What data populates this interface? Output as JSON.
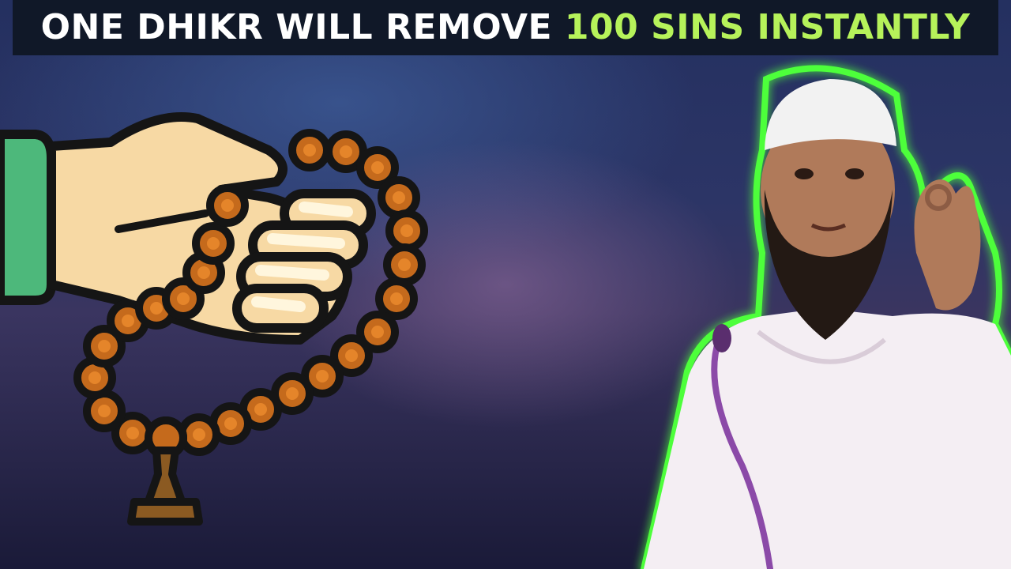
{
  "banner": {
    "text_white": "ONE DHIKR WILL REMOVE ",
    "text_green": "100 SINS INSTANTLY",
    "colors": {
      "background": "#101828",
      "white": "#ffffff",
      "green": "#b6f25a"
    }
  },
  "illustration": {
    "icon": "hand-with-prayer-beads-icon",
    "colors": {
      "sleeve": "#4db87b",
      "skin": "#f7d9a4",
      "bead": "#c56a1c",
      "tassel": "#8b5a22",
      "outline": "#151515"
    }
  },
  "person": {
    "icon": "speaker-with-beard-icon",
    "glow_color": "#4dff3a",
    "robe_color": "#f4eef3",
    "mic_color": "#8b4aa8"
  }
}
